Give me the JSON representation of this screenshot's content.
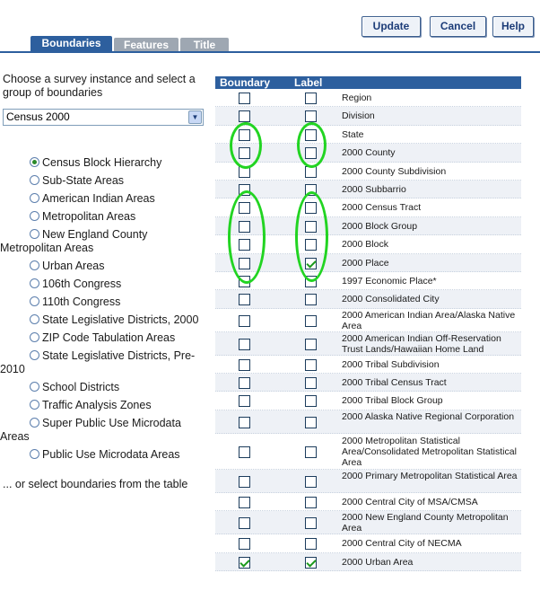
{
  "toolbar": {
    "update": "Update",
    "cancel": "Cancel",
    "help": "Help"
  },
  "tabs": [
    "Boundaries",
    "Features",
    "Title"
  ],
  "left": {
    "intro": "Choose a survey instance and select a group of boundaries",
    "select_value": "Census 2000",
    "radios": [
      {
        "label": "Census Block Hierarchy",
        "selected": true
      },
      {
        "label": "Sub-State Areas",
        "selected": false
      },
      {
        "label": "American Indian Areas",
        "selected": false
      },
      {
        "label": "Metropolitan Areas",
        "selected": false
      },
      {
        "label": "New England County Metropolitan Areas",
        "selected": false
      },
      {
        "label": "Urban Areas",
        "selected": false
      },
      {
        "label": "106th Congress",
        "selected": false
      },
      {
        "label": "110th Congress",
        "selected": false
      },
      {
        "label": "State Legislative Districts, 2000",
        "selected": false
      },
      {
        "label": "ZIP Code Tabulation Areas",
        "selected": false
      },
      {
        "label": "State Legislative Districts, Pre-2010",
        "selected": false
      },
      {
        "label": "School Districts",
        "selected": false
      },
      {
        "label": "Traffic Analysis Zones",
        "selected": false
      },
      {
        "label": "Super Public Use Microdata Areas",
        "selected": false
      },
      {
        "label": "Public Use Microdata Areas",
        "selected": false
      }
    ],
    "trailer": "... or select boundaries from the table"
  },
  "table": {
    "col_boundary": "Boundary",
    "col_label": "Label",
    "rows": [
      {
        "name": "Region",
        "boundary": false,
        "label": false
      },
      {
        "name": "Division",
        "boundary": false,
        "label": false
      },
      {
        "name": "State",
        "boundary": false,
        "label": false
      },
      {
        "name": "2000 County",
        "boundary": false,
        "label": false
      },
      {
        "name": "2000 County Subdivision",
        "boundary": false,
        "label": false
      },
      {
        "name": "2000 Subbarrio",
        "boundary": false,
        "label": false
      },
      {
        "name": "2000 Census Tract",
        "boundary": false,
        "label": false
      },
      {
        "name": "2000 Block Group",
        "boundary": false,
        "label": false
      },
      {
        "name": "2000 Block",
        "boundary": false,
        "label": false
      },
      {
        "name": "2000 Place",
        "boundary": false,
        "label": true
      },
      {
        "name": "1997 Economic Place*",
        "boundary": false,
        "label": false
      },
      {
        "name": "2000 Consolidated City",
        "boundary": false,
        "label": false
      },
      {
        "name": "2000 American Indian Area/Alaska Native Area",
        "boundary": false,
        "label": false
      },
      {
        "name": "2000 American Indian Off-Reservation Trust Lands/Hawaiian Home Land",
        "boundary": false,
        "label": false
      },
      {
        "name": "2000 Tribal Subdivision",
        "boundary": false,
        "label": false
      },
      {
        "name": "2000 Tribal Census Tract",
        "boundary": false,
        "label": false
      },
      {
        "name": "2000 Tribal Block Group",
        "boundary": false,
        "label": false
      },
      {
        "name": "2000 Alaska Native Regional Corporation",
        "boundary": false,
        "label": false
      },
      {
        "name": "2000 Metropolitan Statistical Area/Consolidated Metropolitan Statistical Area",
        "boundary": false,
        "label": false
      },
      {
        "name": "2000 Primary Metropolitan Statistical Area",
        "boundary": false,
        "label": false
      },
      {
        "name": "2000 Central City of MSA/CMSA",
        "boundary": false,
        "label": false
      },
      {
        "name": "2000 New England County Metropolitan Area",
        "boundary": false,
        "label": false
      },
      {
        "name": "2000 Central City of NECMA",
        "boundary": false,
        "label": false
      },
      {
        "name": "2000 Urban Area",
        "boundary": true,
        "label": true
      }
    ]
  },
  "highlight_color": "#22d422"
}
